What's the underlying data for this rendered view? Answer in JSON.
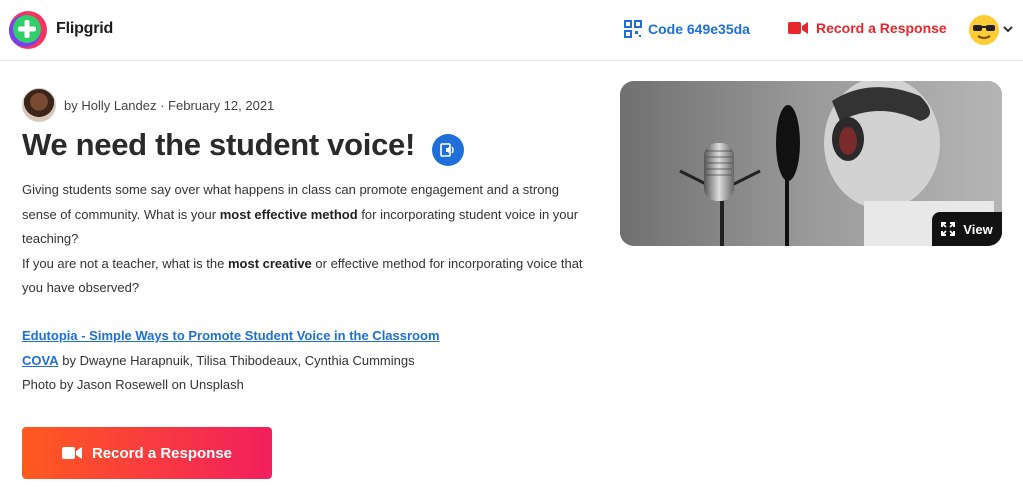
{
  "header": {
    "brand": "Flipgrid",
    "code_label": "Code 649e35da",
    "record_label": "Record a Response"
  },
  "topic": {
    "author_line": "by Holly Landez · February 12, 2021",
    "title": "We need the student voice!",
    "desc": {
      "p1a": "Giving students some say over what happens in class can promote engagement and a strong sense of community. What is your ",
      "p1b": "most effective method",
      "p1c": " for incorporating student voice in your teaching?",
      "p2a": "If you are not a teacher, what is the ",
      "p2b": "most creative",
      "p2c": " or effective method for incorporating voice that you have observed?"
    },
    "links": {
      "l1": "Edutopia - Simple Ways to Promote Student Voice in the Classroom",
      "l2_link": "COVA",
      "l2_rest": " by Dwayne Harapnuik, Tilisa Thibodeaux, Cynthia Cummings",
      "l3": "Photo by Jason Rosewell on Unsplash"
    },
    "cta_label": "Record a Response"
  },
  "media": {
    "view_label": "View"
  },
  "colors": {
    "accent_blue": "#1e6fd9",
    "record_red": "#e8262b",
    "cta_start": "#ff5a1f",
    "cta_end": "#f21f5e"
  }
}
